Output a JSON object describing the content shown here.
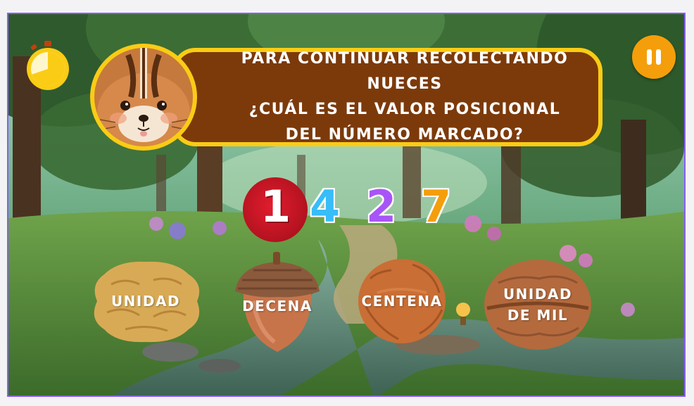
{
  "question": {
    "lines": [
      "PARA CONTINUAR RECOLECTANDO NUECES",
      "¿CUÁL ES EL VALOR POSICIONAL",
      "DEL NÚMERO MARCADO?"
    ]
  },
  "number": {
    "digits": [
      "1",
      "4",
      "2",
      "7"
    ],
    "highlighted_index": 0,
    "digit_colors": [
      "#ffffff",
      "#38bdf8",
      "#a855f7",
      "#f59e0b"
    ]
  },
  "options": [
    {
      "label": "UNIDAD",
      "shape": "walnut-icon"
    },
    {
      "label": "DECENA",
      "shape": "acorn-icon"
    },
    {
      "label": "CENTENA",
      "shape": "hazelnut-icon"
    },
    {
      "label": "UNIDAD DE MIL",
      "label_lines": [
        "UNIDAD",
        "DE MIL"
      ],
      "shape": "walnut-half-icon"
    }
  ],
  "timer": {
    "icon": "stopwatch-icon",
    "elapsed_fraction": 0.62
  },
  "pause": {
    "icon": "pause-icon"
  },
  "character": {
    "icon": "chipmunk-icon"
  },
  "colors": {
    "question_bg": "#7c3a0b",
    "question_border": "#facc15",
    "pause_button": "#f59e0b",
    "marker": "#c81e2a",
    "frame_border": "#8b5cf6"
  }
}
